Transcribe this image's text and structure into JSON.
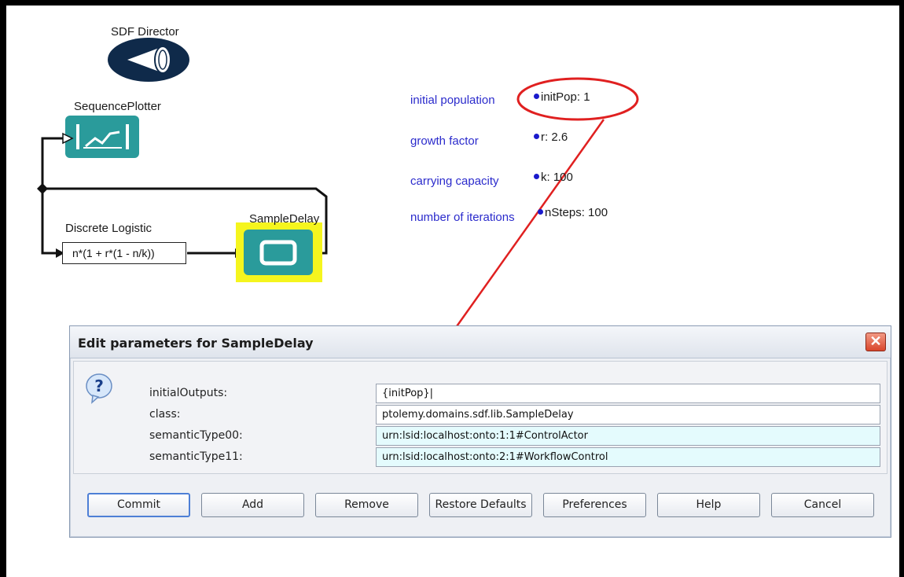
{
  "workflow": {
    "director_label": "SDF Director",
    "plotter_label": "SequencePlotter",
    "logistic_label": "Discrete Logistic",
    "logistic_expression": "n*(1 + r*(1 - n/k))",
    "sampledelay_label": "SampleDelay",
    "parameters": [
      {
        "name": "initial population",
        "value": "initPop: 1"
      },
      {
        "name": "growth factor",
        "value": "r: 2.6"
      },
      {
        "name": "carrying capacity",
        "value": "k: 100"
      },
      {
        "name": "number of iterations",
        "value": "nSteps: 100"
      }
    ],
    "annotation_color": "#e02020",
    "highlight_color": "#f5f51e",
    "actor_color": "#2a9b9b"
  },
  "dialog": {
    "title": "Edit parameters for SampleDelay",
    "fields": [
      {
        "label": "initialOutputs:",
        "value": "{initPop}|"
      },
      {
        "label": "class:",
        "value": "ptolemy.domains.sdf.lib.SampleDelay"
      },
      {
        "label": "semanticType00:",
        "value": "urn:lsid:localhost:onto:1:1#ControlActor"
      },
      {
        "label": "semanticType11:",
        "value": "urn:lsid:localhost:onto:2:1#WorkflowControl"
      }
    ],
    "buttons": {
      "commit": "Commit",
      "add": "Add",
      "remove": "Remove",
      "restore": "Restore Defaults",
      "preferences": "Preferences",
      "help": "Help",
      "cancel": "Cancel"
    },
    "close_glyph": "✕",
    "question_glyph": "?"
  }
}
